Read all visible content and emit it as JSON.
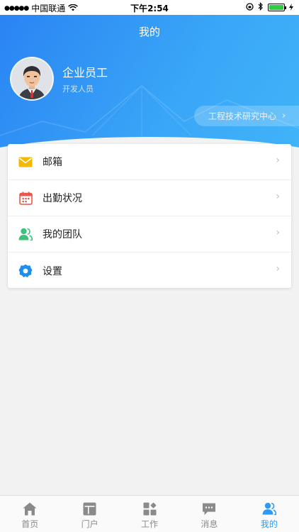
{
  "status_bar": {
    "carrier": "中国联通",
    "time": "下午2:54"
  },
  "page": {
    "title": "我的"
  },
  "profile": {
    "name": "企业员工",
    "role": "开发人员",
    "department": "工程技术研究中心"
  },
  "menu": {
    "items": [
      {
        "label": "邮箱",
        "icon": "mail-icon"
      },
      {
        "label": "出勤状况",
        "icon": "calendar-icon"
      },
      {
        "label": "我的团队",
        "icon": "team-icon"
      },
      {
        "label": "设置",
        "icon": "gear-icon"
      }
    ]
  },
  "tabbar": {
    "tabs": [
      {
        "label": "首页",
        "icon": "home-icon"
      },
      {
        "label": "门户",
        "icon": "portal-icon"
      },
      {
        "label": "工作",
        "icon": "work-icon"
      },
      {
        "label": "消息",
        "icon": "message-icon"
      },
      {
        "label": "我的",
        "icon": "profile-icon",
        "active": true
      }
    ]
  },
  "colors": {
    "accent": "#2d9af4",
    "header_start": "#2a84f3",
    "header_end": "#41b4f9",
    "mail": "#f5b800",
    "calendar": "#e8574a",
    "team": "#3cc27a",
    "settings": "#1f8ef1"
  }
}
